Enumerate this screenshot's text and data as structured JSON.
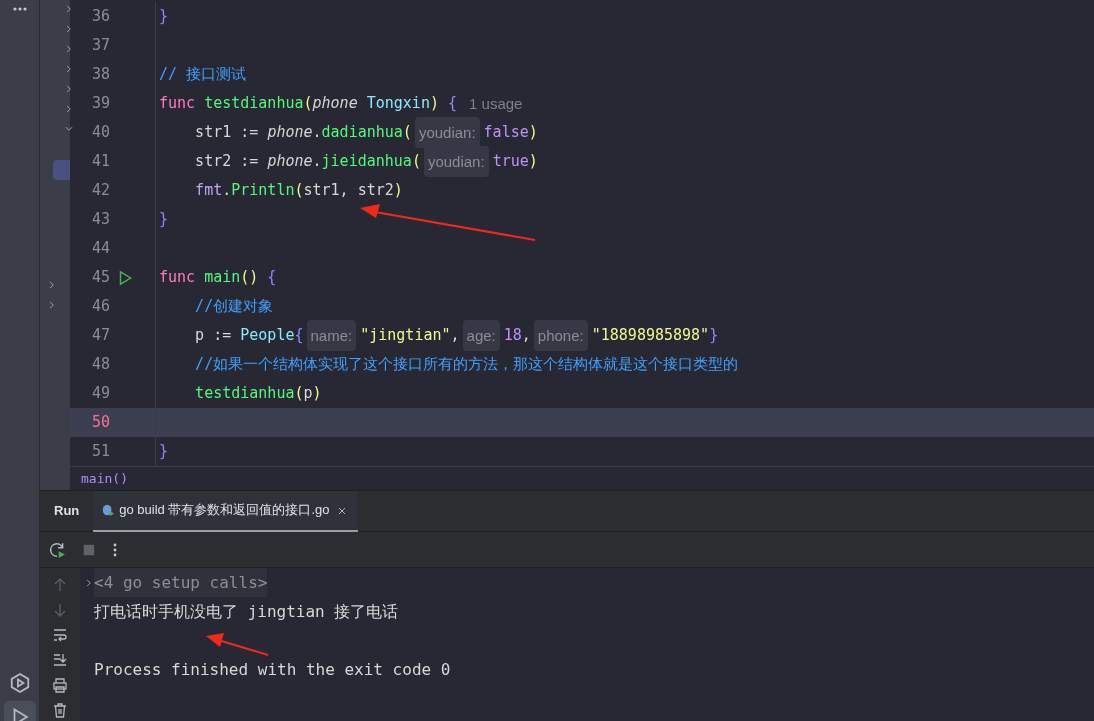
{
  "activity_bar": {
    "items": [
      {
        "kind": "services",
        "selected": false
      },
      {
        "kind": "run",
        "selected": true
      }
    ]
  },
  "editor": {
    "lines": [
      {
        "number": "36",
        "current": false,
        "tokens": [
          {
            "kind": "brace",
            "text": "}"
          }
        ]
      },
      {
        "number": "37",
        "current": false
      },
      {
        "number": "38",
        "current": false,
        "tokens": [
          {
            "kind": "comment",
            "text": "// 接口测试"
          }
        ]
      },
      {
        "number": "39",
        "current": false,
        "tokens": [
          {
            "kind": "keyword",
            "text": "func"
          },
          {
            "kind": "fn",
            "text": " testdianhua"
          },
          {
            "kind": "paren",
            "text": "("
          },
          {
            "kind": "param",
            "text": "phone"
          },
          {
            "kind": "type",
            "text": " Tongxin"
          },
          {
            "kind": "paren",
            "text": ")"
          },
          {
            "kind": "brace",
            "text": " {"
          },
          {
            "kind": "usage",
            "text": "1 usage"
          }
        ]
      },
      {
        "number": "40",
        "current": false,
        "tokens": [
          {
            "kind": "plain",
            "text": "    str1 := "
          },
          {
            "kind": "param",
            "text": "phone"
          },
          {
            "kind": "plain",
            "text": "."
          },
          {
            "kind": "fn",
            "text": "dadianhua"
          },
          {
            "kind": "paren",
            "text": "("
          },
          {
            "kind": "hint",
            "text": "youdian:"
          },
          {
            "kind": "const",
            "text": "false"
          },
          {
            "kind": "paren",
            "text": ")"
          }
        ]
      },
      {
        "number": "41",
        "current": false,
        "tokens": [
          {
            "kind": "plain",
            "text": "    str2 := "
          },
          {
            "kind": "param",
            "text": "phone"
          },
          {
            "kind": "plain",
            "text": "."
          },
          {
            "kind": "fn",
            "text": "jieidanhua"
          },
          {
            "kind": "paren",
            "text": "("
          },
          {
            "kind": "hint",
            "text": "youdian:"
          },
          {
            "kind": "const",
            "text": "true"
          },
          {
            "kind": "paren",
            "text": ")"
          }
        ]
      },
      {
        "number": "42",
        "current": false,
        "tokens": [
          {
            "kind": "pkg",
            "text": "    fmt"
          },
          {
            "kind": "plain",
            "text": "."
          },
          {
            "kind": "fn",
            "text": "Println"
          },
          {
            "kind": "paren",
            "text": "("
          },
          {
            "kind": "plain",
            "text": "str1, str2"
          },
          {
            "kind": "paren",
            "text": ")"
          }
        ]
      },
      {
        "number": "43",
        "current": false,
        "tokens": [
          {
            "kind": "brace",
            "text": "}"
          }
        ]
      },
      {
        "number": "44",
        "current": false
      },
      {
        "number": "45",
        "current": false,
        "run_marker": true,
        "tokens": [
          {
            "kind": "keyword",
            "text": "func"
          },
          {
            "kind": "fn",
            "text": " main"
          },
          {
            "kind": "paren",
            "text": "()"
          },
          {
            "kind": "brace",
            "text": " {"
          }
        ]
      },
      {
        "number": "46",
        "current": false,
        "tokens": [
          {
            "kind": "comment",
            "text": "    //创建对象"
          }
        ]
      },
      {
        "number": "47",
        "current": false,
        "tokens": [
          {
            "kind": "plain",
            "text": "    p := "
          },
          {
            "kind": "type",
            "text": "People"
          },
          {
            "kind": "brace",
            "text": "{"
          },
          {
            "kind": "hint",
            "text": "name:"
          },
          {
            "kind": "string",
            "text": "\"jingtian\""
          },
          {
            "kind": "plain",
            "text": ","
          },
          {
            "kind": "hint",
            "text": "age:"
          },
          {
            "kind": "const",
            "text": "18"
          },
          {
            "kind": "plain",
            "text": ","
          },
          {
            "kind": "hint",
            "text": "phone:"
          },
          {
            "kind": "string",
            "text": "\"18898985898\""
          },
          {
            "kind": "brace",
            "text": "}"
          }
        ]
      },
      {
        "number": "48",
        "current": false,
        "tokens": [
          {
            "kind": "comment",
            "text": "    //如果一个结构体实现了这个接口所有的方法，那这个结构体就是这个接口类型的"
          }
        ]
      },
      {
        "number": "49",
        "current": false,
        "tokens": [
          {
            "kind": "fn",
            "text": "    testdianhua"
          },
          {
            "kind": "paren",
            "text": "("
          },
          {
            "kind": "plain",
            "text": "p"
          },
          {
            "kind": "paren",
            "text": ")"
          }
        ]
      },
      {
        "number": "50",
        "current": true
      },
      {
        "number": "51",
        "current": false,
        "tokens": [
          {
            "kind": "brace",
            "text": "}"
          }
        ]
      }
    ],
    "breadcrumb": "main()"
  },
  "run_panel": {
    "title": "Run",
    "tabs": [
      {
        "label": "go build 带有参数和返回值的接口.go",
        "selected": true
      }
    ],
    "console": {
      "folded": "<4 go setup calls>",
      "lines": [
        "打电话时手机没电了 jingtian 接了电话",
        "Process finished with the exit code 0"
      ]
    }
  }
}
